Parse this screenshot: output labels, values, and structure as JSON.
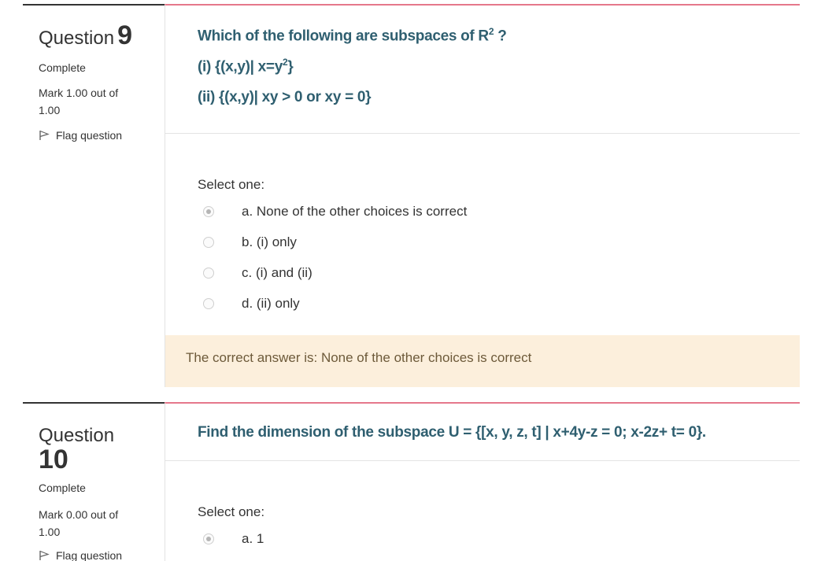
{
  "questions": [
    {
      "label": "Question",
      "number": "9",
      "state": "Complete",
      "grade": "Mark 1.00 out of 1.00",
      "flag_label": "Flag question",
      "text": {
        "line1_main": "Which of the following are subspaces of R",
        "line1_sup": "2",
        "line1_tail": " ?",
        "line2_main": "(i) {(x,y)| x=y",
        "line2_sup": "2",
        "line2_tail": "}",
        "line3": "(ii) {(x,y)| xy > 0 or xy = 0}"
      },
      "select_label": "Select one:",
      "options": [
        {
          "label": "a. None of the other choices is correct",
          "checked": true
        },
        {
          "label": "b. (i) only",
          "checked": false
        },
        {
          "label": "c. (i) and (ii)",
          "checked": false
        },
        {
          "label": "d. (ii) only",
          "checked": false
        }
      ],
      "feedback": "The correct answer is: None of the other choices is correct"
    },
    {
      "label": "Question",
      "number": "10",
      "state": "Complete",
      "grade": "Mark 0.00 out of 1.00",
      "flag_label": "Flag question",
      "text": {
        "line1": "Find the dimension of the subspace U = {[x, y, z, t] | x+4y-z = 0; x-2z+ t= 0}."
      },
      "select_label": "Select one:",
      "options": [
        {
          "label": "a. 1",
          "checked": true
        }
      ]
    }
  ],
  "icons": {
    "flag": "flag-icon",
    "radio": "radio-icon"
  },
  "colors": {
    "accent_border": "#e5788b",
    "question_text": "#2f5f70",
    "feedback_bg": "#fcefdc"
  }
}
